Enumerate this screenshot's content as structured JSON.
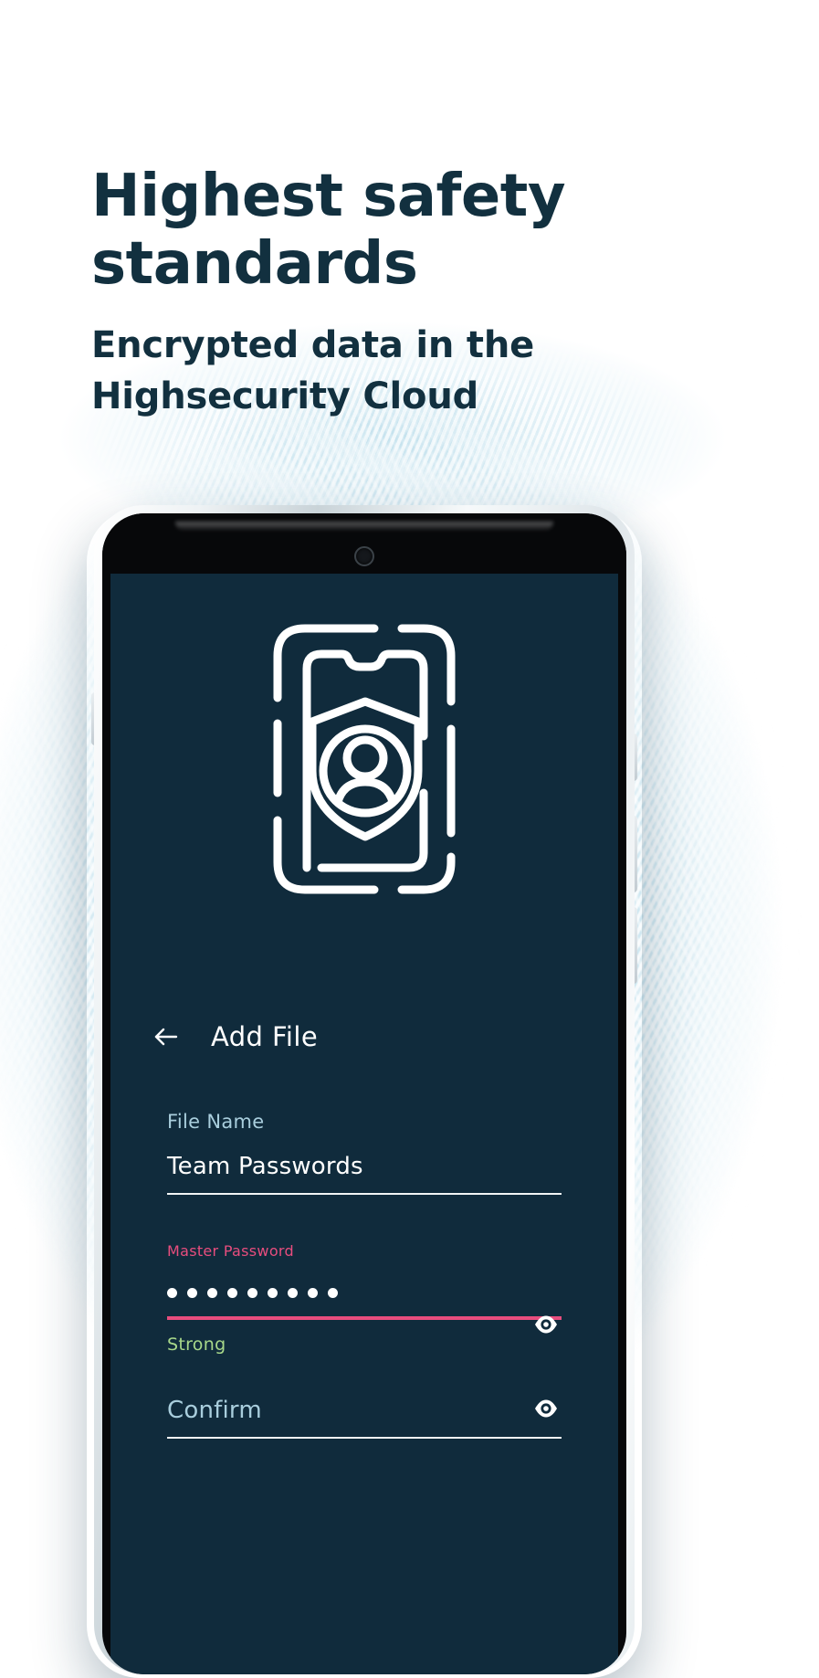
{
  "marketing": {
    "headline_line1": "Highest safety",
    "headline_line2": "standards",
    "subtitle_line1": "Encrypted data in the",
    "subtitle_line2": "Highsecurity Cloud"
  },
  "colors": {
    "headline": "#12303f",
    "screen_bg": "#102b3c",
    "accent_pink": "#e84d7e",
    "label_blue": "#a9cedd",
    "strength_green": "#a8d88a",
    "texture_blue": "#b0d8e8",
    "white": "#ffffff"
  },
  "app": {
    "appbar": {
      "back_label": "Back",
      "title": "Add File"
    },
    "illustration": {
      "name": "phone-shield-user-illustration"
    },
    "form": {
      "file_name": {
        "label": "File Name",
        "value": "Team Passwords",
        "placeholder": "File Name"
      },
      "master_password": {
        "label": "Master Password",
        "value": "•••••••••",
        "masked_char_count": 9,
        "placeholder": "Master Password",
        "reveal_label": "Show password",
        "strength": "Strong"
      },
      "confirm": {
        "label": "Confirm",
        "value": "",
        "placeholder": "Confirm",
        "reveal_label": "Show password"
      }
    }
  }
}
